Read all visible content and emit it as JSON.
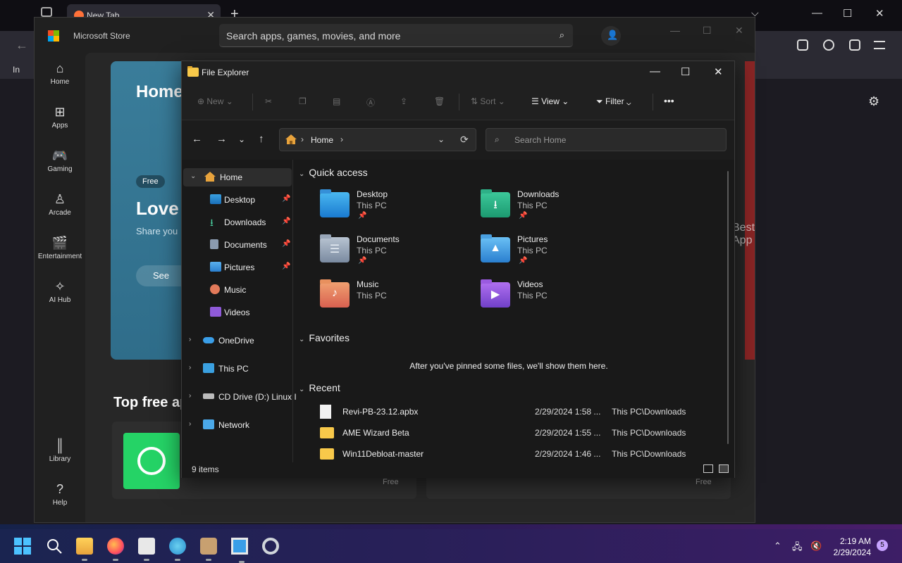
{
  "browser": {
    "tab_title": "New Tab",
    "tab_close": "✕",
    "new_tab": "+",
    "overflow": "⌵",
    "min": "—",
    "max": "☐",
    "close": "✕",
    "back": "←",
    "bookmark_item": "In",
    "settings_icon": "⚙"
  },
  "store": {
    "title": "Microsoft Store",
    "search_placeholder": "Search apps, games, movies, and more",
    "nav": [
      {
        "label": "Home",
        "icon": "⌂"
      },
      {
        "label": "Apps",
        "icon": "⊞"
      },
      {
        "label": "Gaming",
        "icon": "🎮"
      },
      {
        "label": "Arcade",
        "icon": "♙"
      },
      {
        "label": "Entertainment",
        "icon": "🎬"
      },
      {
        "label": "AI Hub",
        "icon": "✧"
      },
      {
        "label": "Library",
        "icon": "║"
      },
      {
        "label": "Help",
        "icon": "?"
      }
    ],
    "hero_title": "Home",
    "free_pill": "Free",
    "hero_heading": "Love",
    "hero_sub": "Share you",
    "see_button": "See",
    "top_free": "Top free ap",
    "free_1": "Free",
    "free_2": "Free",
    "best_app": "Best App"
  },
  "explorer": {
    "title": "File Explorer",
    "toolbar": {
      "new": "New",
      "sort": "Sort",
      "view": "View",
      "filter": "Filter",
      "more": "•••"
    },
    "breadcrumb": "Home",
    "search_placeholder": "Search Home",
    "nav": [
      {
        "label": "Home",
        "pinned": false
      },
      {
        "label": "Desktop",
        "pinned": true
      },
      {
        "label": "Downloads",
        "pinned": true
      },
      {
        "label": "Documents",
        "pinned": true
      },
      {
        "label": "Pictures",
        "pinned": true
      },
      {
        "label": "Music",
        "pinned": false
      },
      {
        "label": "Videos",
        "pinned": false
      },
      {
        "label": "OneDrive",
        "pinned": false
      },
      {
        "label": "This PC",
        "pinned": false
      },
      {
        "label": "CD Drive (D:) Linux I",
        "pinned": false
      },
      {
        "label": "Network",
        "pinned": false
      }
    ],
    "quick_access_label": "Quick access",
    "quick_access": [
      {
        "name": "Desktop",
        "location": "This PC",
        "pinned": true
      },
      {
        "name": "Downloads",
        "location": "This PC",
        "pinned": true
      },
      {
        "name": "Documents",
        "location": "This PC",
        "pinned": true
      },
      {
        "name": "Pictures",
        "location": "This PC",
        "pinned": true
      },
      {
        "name": "Music",
        "location": "This PC",
        "pinned": false
      },
      {
        "name": "Videos",
        "location": "This PC",
        "pinned": false
      }
    ],
    "favorites_label": "Favorites",
    "favorites_empty": "After you've pinned some files, we'll show them here.",
    "recent_label": "Recent",
    "recent": [
      {
        "name": "Revi-PB-23.12.apbx",
        "date": "2/29/2024 1:58 ...",
        "location": "This PC\\Downloads",
        "type": "file"
      },
      {
        "name": "AME Wizard Beta",
        "date": "2/29/2024 1:55 ...",
        "location": "This PC\\Downloads",
        "type": "folder"
      },
      {
        "name": "Win11Debloat-master",
        "date": "2/29/2024 1:46 ...",
        "location": "This PC\\Downloads",
        "type": "folder"
      }
    ],
    "status_count": "9 items"
  },
  "taskbar": {
    "time": "2:19 AM",
    "date": "2/29/2024",
    "notifications": "5"
  },
  "colors": {
    "accent": "#4cc2ff",
    "folder": "#f8c94a"
  }
}
